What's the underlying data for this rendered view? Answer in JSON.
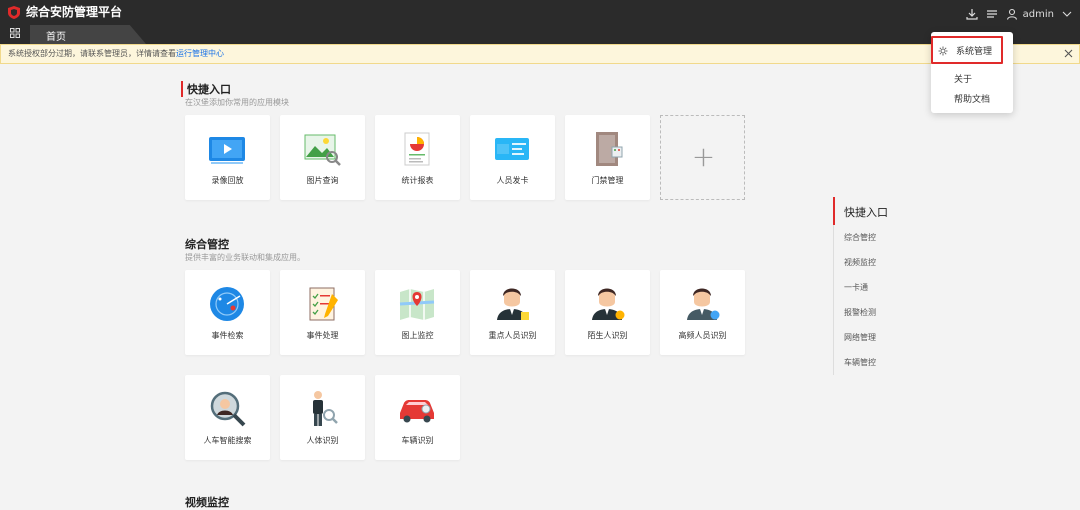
{
  "app": {
    "title": "综合安防管理平台",
    "user": "admin",
    "logo_icon": "shield-logo-icon"
  },
  "tabs": {
    "home": "首页"
  },
  "notice": {
    "text": "系统授权部分过期，请联系管理员，详情请查看",
    "link": "运行管理中心"
  },
  "quick_entry": {
    "title": "快捷入口",
    "subtitle": "在汉堡添加你常用的应用模块",
    "items": [
      "录像回放",
      "图片查询",
      "统计报表",
      "人员发卡",
      "门禁管理"
    ],
    "add_label": "+"
  },
  "integrated": {
    "title": "综合管控",
    "subtitle": "提供丰富的业务联动和集成应用。",
    "items": [
      "事件检索",
      "事件处理",
      "图上监控",
      "重点人员识别",
      "陌生人识别",
      "高频人员识别",
      "人车智能搜索",
      "人体识别",
      "车辆识别"
    ]
  },
  "video": {
    "title": "视频监控"
  },
  "right_nav": {
    "items": [
      "快捷入口",
      "综合管控",
      "视频监控",
      "一卡通",
      "报警检测",
      "网络管理",
      "车辆管控"
    ]
  },
  "dropdown": {
    "items": [
      "系统管理",
      "关于",
      "帮助文档"
    ]
  },
  "colors": {
    "accent": "#e02a2a",
    "topbar": "#2b2b2b",
    "link": "#1a73e8"
  }
}
